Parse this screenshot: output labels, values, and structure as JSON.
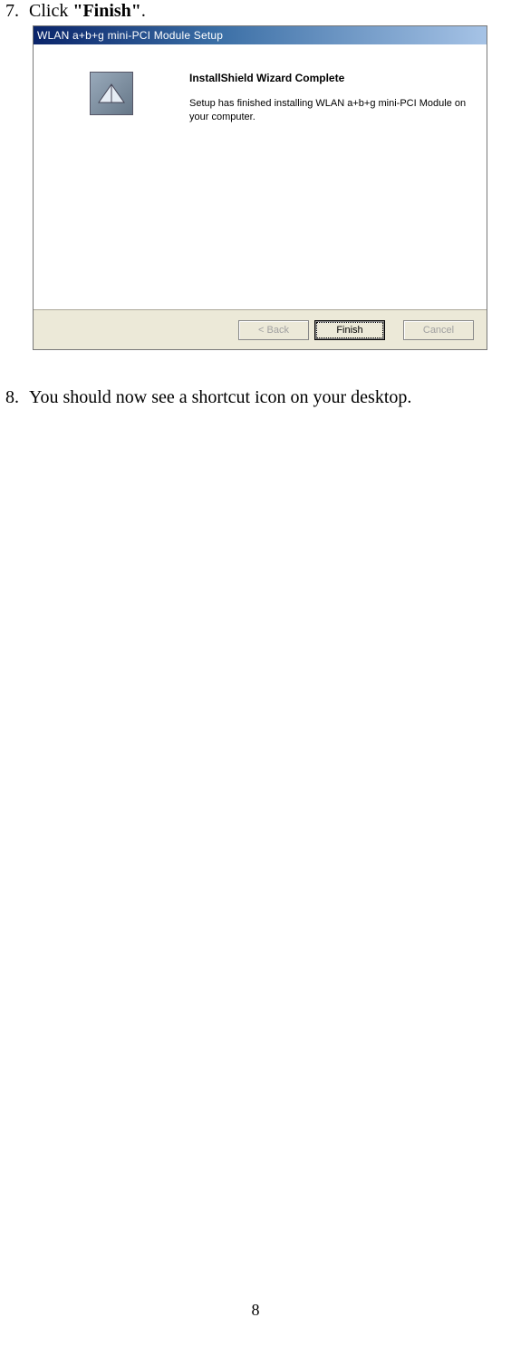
{
  "steps": {
    "s7": {
      "num": "7.",
      "pre": "Click ",
      "bold": "\"Finish\"",
      "post": "."
    },
    "s8": {
      "num": "8.",
      "text": "You should now see a shortcut icon on your desktop."
    }
  },
  "wizard": {
    "title": "WLAN a+b+g mini-PCI Module Setup",
    "heading": "InstallShield Wizard Complete",
    "body": "Setup has finished installing WLAN a+b+g mini-PCI Module on your computer.",
    "buttons": {
      "back": "< Back",
      "finish": "Finish",
      "cancel": "Cancel"
    }
  },
  "page_number": "8"
}
